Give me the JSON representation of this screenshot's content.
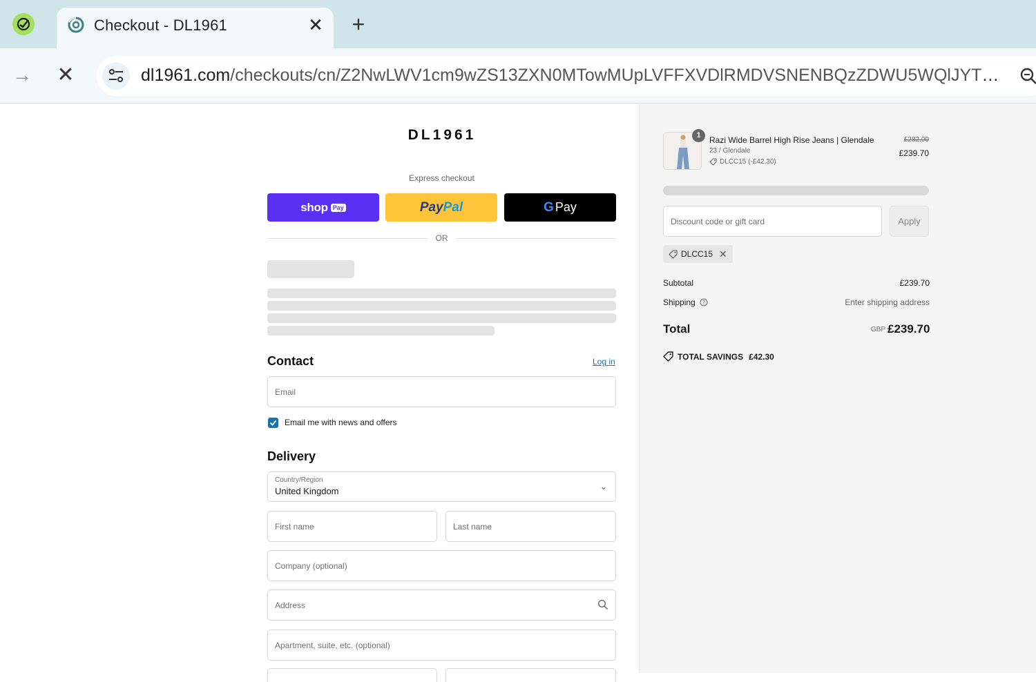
{
  "browser": {
    "tab_title": "Checkout - DL1961",
    "url_host": "dl1961.com",
    "url_path": "/checkouts/cn/Z2NwLWV1cm9wZS13ZXN0MTowMUpLVFFXVDlRMDVSNENBQzZDWU5WQlJYTQ?locale..."
  },
  "brand": {
    "logo_text": "DL1961"
  },
  "express": {
    "label": "Express checkout",
    "shop_pay": "shop",
    "shop_pay_pill": "Pay",
    "paypal_a": "Pay",
    "paypal_b": "Pal",
    "gpay_g": "G",
    "gpay_text": "Pay",
    "or_text": "OR"
  },
  "contact": {
    "title": "Contact",
    "login_link": "Log in",
    "email_placeholder": "Email",
    "newsletter_label": "Email me with news and offers",
    "newsletter_checked": true
  },
  "delivery": {
    "title": "Delivery",
    "country_label": "Country/Region",
    "country_value": "United Kingdom",
    "first_name_placeholder": "First name",
    "last_name_placeholder": "Last name",
    "company_placeholder": "Company (optional)",
    "address_placeholder": "Address",
    "apartment_placeholder": "Apartment, suite, etc. (optional)"
  },
  "summary": {
    "item": {
      "quantity": "1",
      "name": "Razi Wide Barrel High Rise Jeans | Glendale",
      "variant": "23 / Glendale",
      "discount": "DLCC15 (-£42.30)",
      "price_original": "£282.00",
      "price": "£239.70"
    },
    "discount_placeholder": "Discount code or gift card",
    "apply_label": "Apply",
    "applied_code": "DLCC15",
    "subtotal_label": "Subtotal",
    "subtotal_value": "£239.70",
    "shipping_label": "Shipping",
    "shipping_value": "Enter shipping address",
    "total_label": "Total",
    "total_currency": "GBP",
    "total_value": "£239.70",
    "savings_label": "TOTAL SAVINGS",
    "savings_value": "£42.30"
  },
  "colors": {
    "shop_pay": "#5a31f4",
    "paypal": "#ffc439",
    "gpay": "#000000",
    "link": "#1773b0",
    "tabbar": "#cfe5ea"
  }
}
